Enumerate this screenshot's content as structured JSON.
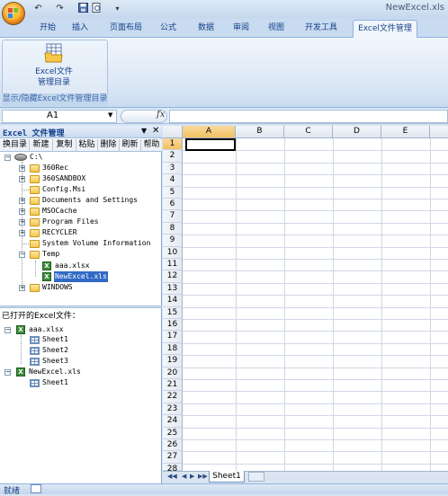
{
  "window": {
    "title": "NewExcel.xls"
  },
  "quick_access": {
    "icons": [
      "undo-icon",
      "redo-icon",
      "save-icon",
      "print-preview-icon",
      "customize-icon"
    ]
  },
  "tabs": [
    {
      "label": "开始"
    },
    {
      "label": "插入"
    },
    {
      "label": "页面布局"
    },
    {
      "label": "公式"
    },
    {
      "label": "数据"
    },
    {
      "label": "审阅"
    },
    {
      "label": "视图"
    },
    {
      "label": "开发工具"
    },
    {
      "label": "Excel文件管理",
      "active": true
    }
  ],
  "ribbon": {
    "button_line1": "Excel文件",
    "button_line2": "管理目录",
    "group_label": "显示/隐藏Excel文件管理目录"
  },
  "formula_bar": {
    "name_box": "A1",
    "fx": "fx",
    "value": ""
  },
  "pane": {
    "title": "Excel 文件管理",
    "toolbar": [
      "换目录",
      "新建",
      "复制",
      "粘贴",
      "删除",
      "刷新",
      "帮助"
    ],
    "drive": "C:\\",
    "folders": [
      {
        "name": "360Rec",
        "expandable": true
      },
      {
        "name": "360SANDBOX",
        "expandable": true
      },
      {
        "name": "Config.Msi",
        "expandable": false
      },
      {
        "name": "Documents and Settings",
        "expandable": true
      },
      {
        "name": "MSOCache",
        "expandable": true
      },
      {
        "name": "Program Files",
        "expandable": true
      },
      {
        "name": "RECYCLER",
        "expandable": true
      },
      {
        "name": "System Volume Information",
        "expandable": false
      },
      {
        "name": "Temp",
        "expanded": true
      },
      {
        "name": "WINDOWS",
        "expandable": true
      }
    ],
    "temp_files": [
      "aaa.xlsx",
      "NewExcel.xls"
    ],
    "opened_label": "已打开的Excel文件：",
    "opened_files": [
      {
        "name": "aaa.xlsx",
        "sheets": [
          "Sheet1",
          "Sheet2",
          "Sheet3"
        ]
      },
      {
        "name": "NewExcel.xls",
        "sheets": [
          "Sheet1"
        ]
      }
    ]
  },
  "grid": {
    "columns": [
      "A",
      "B",
      "C",
      "D",
      "E"
    ],
    "rows": [
      "1",
      "2",
      "3",
      "4",
      "5",
      "6",
      "7",
      "8",
      "9",
      "10",
      "11",
      "12",
      "13",
      "14",
      "15",
      "16",
      "17",
      "18",
      "19",
      "20",
      "21",
      "22",
      "23",
      "24",
      "25",
      "26",
      "27",
      "28"
    ],
    "selected_cell": "A1"
  },
  "sheet_tabs": {
    "active": "Sheet1"
  },
  "status": {
    "text": "就绪"
  },
  "colors": {
    "ribbon_bg": "#dbe7f5",
    "selected_header": "#f1c15f",
    "accent": "#15428b"
  }
}
